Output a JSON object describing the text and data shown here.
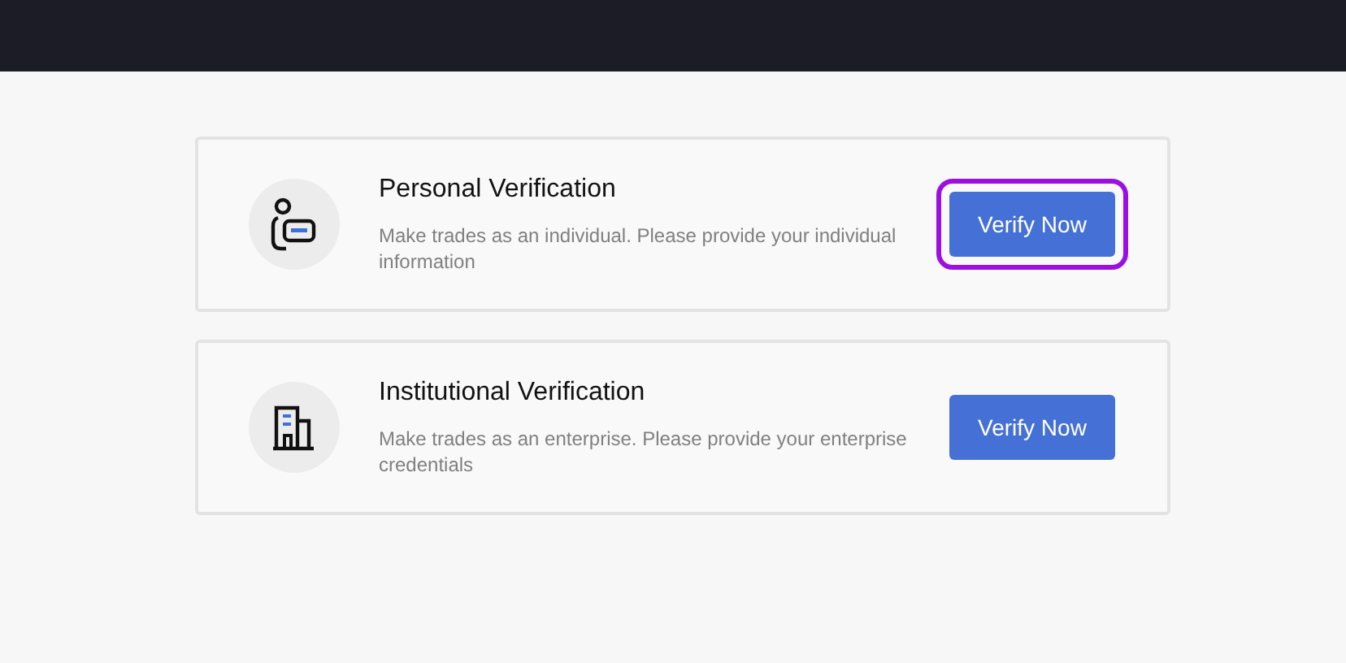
{
  "options": [
    {
      "kind": "person",
      "title": "Personal Verification",
      "description": "Make trades as an individual. Please provide your individual information",
      "button": "Verify Now",
      "highlighted": true
    },
    {
      "kind": "building",
      "title": "Institutional Verification",
      "description": "Make trades as an enterprise. Please provide your enterprise credentials",
      "button": "Verify Now",
      "highlighted": false
    }
  ]
}
